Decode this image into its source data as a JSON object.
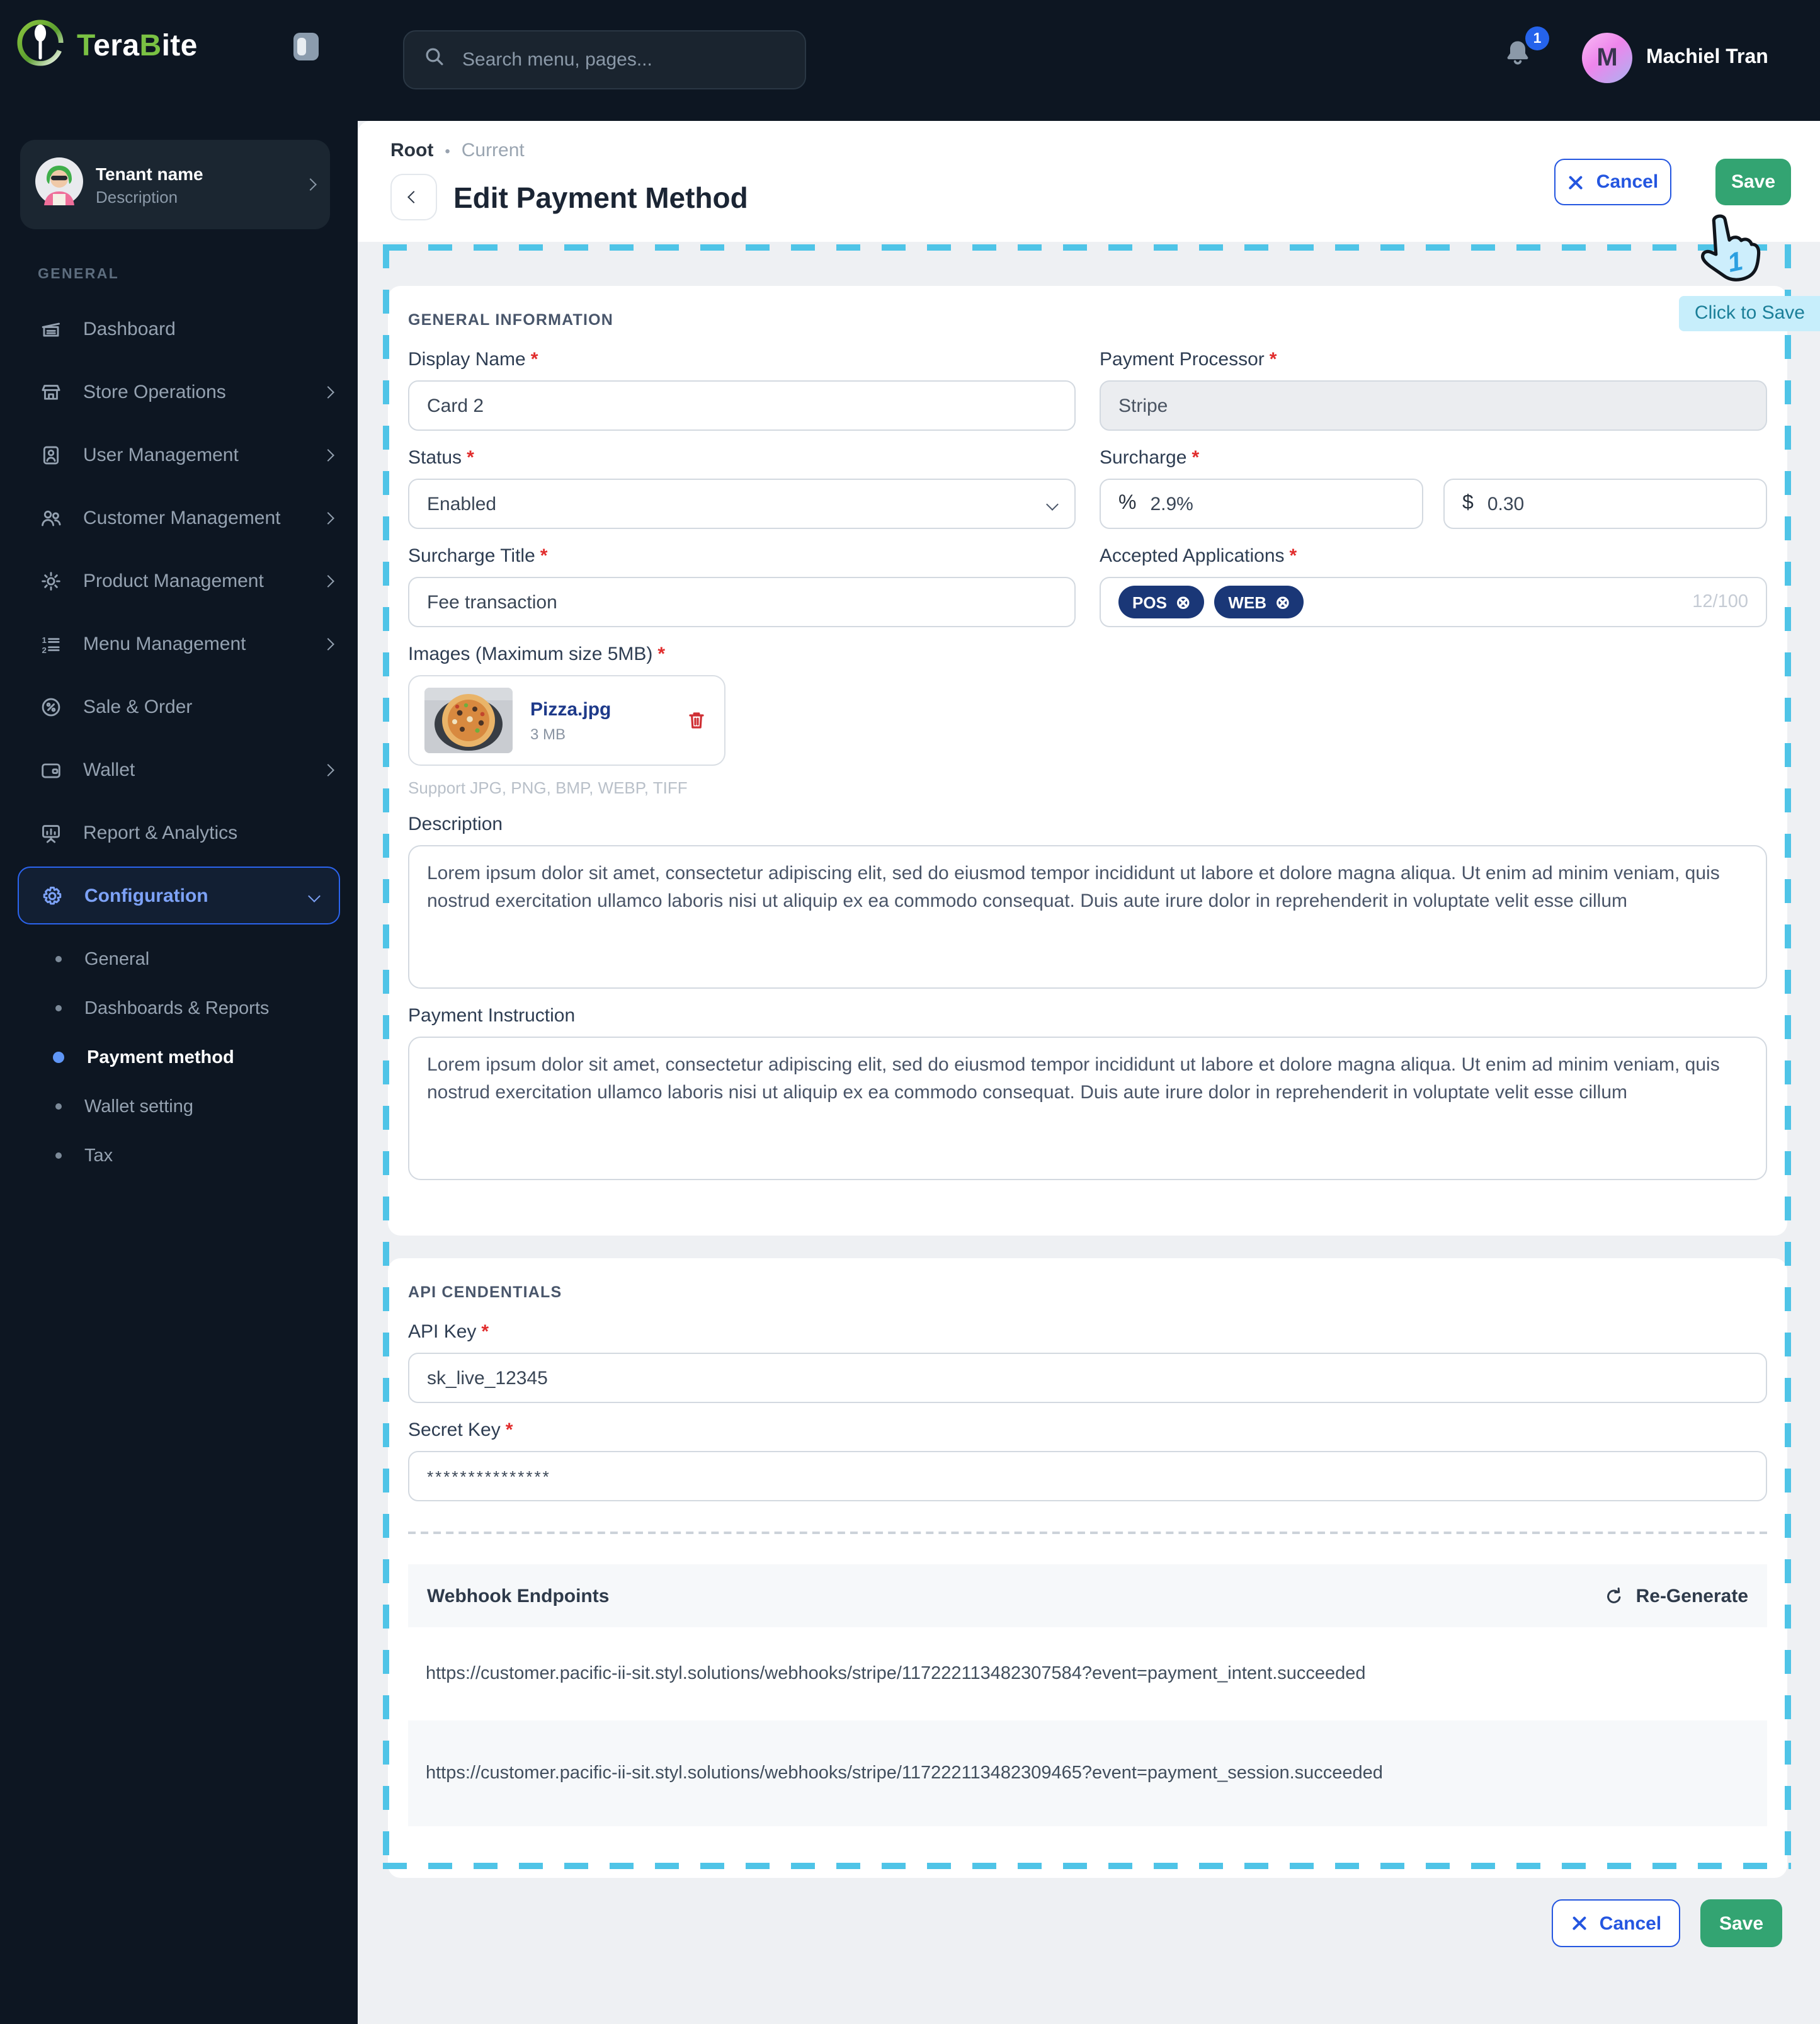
{
  "topbar": {
    "logo": {
      "p1": "T",
      "p2": "era",
      "p3": "B",
      "p4": "ite"
    },
    "search_placeholder": "Search menu, pages...",
    "notification_count": "1",
    "user_initial": "M",
    "user_name": "Machiel Tran"
  },
  "tenant": {
    "name": "Tenant name",
    "description": "Description"
  },
  "sidebar": {
    "section_label": "GENERAL",
    "items": [
      {
        "label": "Dashboard"
      },
      {
        "label": "Store Operations"
      },
      {
        "label": "User Management"
      },
      {
        "label": "Customer Management"
      },
      {
        "label": "Product Management"
      },
      {
        "label": "Menu Management"
      },
      {
        "label": "Sale & Order"
      },
      {
        "label": "Wallet"
      },
      {
        "label": "Report & Analytics"
      },
      {
        "label": "Configuration"
      }
    ],
    "config_children": [
      "General",
      "Dashboards & Reports",
      "Payment method",
      "Wallet setting",
      "Tax"
    ]
  },
  "page": {
    "breadcrumb_root": "Root",
    "breadcrumb_separator": "•",
    "breadcrumb_current": "Current",
    "title": "Edit Payment Method",
    "cancel_label": "Cancel",
    "save_label": "Save",
    "tooltip": "Click to Save",
    "cursor_step": "1"
  },
  "form": {
    "required_marker": "*",
    "section1_title": "GENERAL INFORMATION",
    "display_name": {
      "label": "Display Name",
      "value": "Card 2"
    },
    "payment_processor": {
      "label": "Payment Processor",
      "value": "Stripe"
    },
    "status": {
      "label": "Status",
      "value": "Enabled"
    },
    "surcharge": {
      "label": "Surcharge",
      "percent_prefix": "%",
      "percent_value": "2.9%",
      "amount_prefix": "$",
      "amount_value": "0.30"
    },
    "surcharge_title": {
      "label": "Surcharge Title",
      "value": "Fee transaction"
    },
    "accepted_applications": {
      "label": "Accepted Applications",
      "chips": [
        {
          "label": "POS"
        },
        {
          "label": "WEB"
        }
      ],
      "remove_icon": "⊗",
      "counter": "12/100"
    },
    "images": {
      "label": "Images (Maximum size 5MB)",
      "file_name": "Pizza.jpg",
      "file_size": "3 MB",
      "support_text": "Support JPG, PNG, BMP, WEBP, TIFF"
    },
    "description": {
      "label": "Description",
      "value": "Lorem ipsum dolor sit amet, consectetur adipiscing elit, sed do eiusmod tempor incididunt ut labore et dolore magna aliqua. Ut enim ad minim veniam, quis nostrud exercitation ullamco laboris nisi ut aliquip ex ea commodo consequat. Duis aute irure dolor in reprehenderit in voluptate velit esse cillum"
    },
    "payment_instruction": {
      "label": "Payment Instruction",
      "value": "Lorem ipsum dolor sit amet, consectetur adipiscing elit, sed do eiusmod tempor incididunt ut labore et dolore magna aliqua. Ut enim ad minim veniam, quis nostrud exercitation ullamco laboris nisi ut aliquip ex ea commodo consequat. Duis aute irure dolor in reprehenderit in voluptate velit esse cillum"
    },
    "section2_title": "API CENDENTIALS",
    "api_key": {
      "label": "API Key",
      "value": "sk_live_12345"
    },
    "secret_key": {
      "label": "Secret Key",
      "value": "***************"
    },
    "webhooks": {
      "title": "Webhook Endpoints",
      "regenerate_label": "Re-Generate",
      "url1": "https://customer.pacific-ii-sit.styl.solutions/webhooks/stripe/117222113482307584?event=payment_intent.succeeded",
      "url2": "https://customer.pacific-ii-sit.styl.solutions/webhooks/stripe/117222113482309465?event=payment_session.succeeded"
    }
  },
  "footer": {
    "cancel_label": "Cancel",
    "save_label": "Save"
  },
  "colors": {
    "sidebar_bg": "#0d1622",
    "accent_blue": "#2456e0",
    "save_green": "#33a472",
    "annotation_cyan": "#4fc4e7",
    "chip_navy": "#1a3777",
    "danger_red": "#cf2f34",
    "logo_green": "#7ac143"
  }
}
